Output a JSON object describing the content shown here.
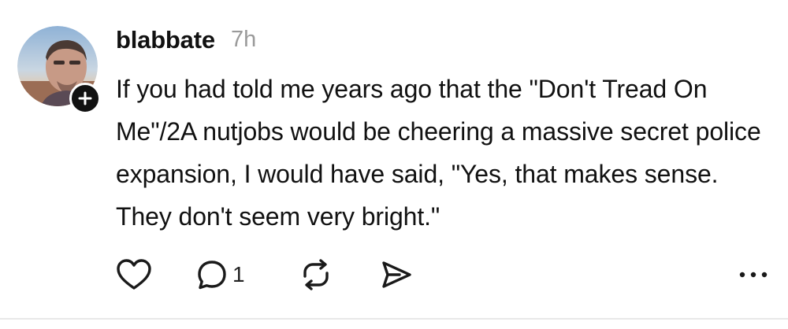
{
  "post": {
    "username": "blabbate",
    "timestamp": "7h",
    "text": "If you had told me years ago that the \"Don't Tread On Me\"/2A nutjobs would be cheering a massive secret police expansion, I would have said, \"Yes, that makes sense. They don't seem very bright.\"",
    "avatar": {
      "icon": "profile-photo",
      "follow_badge_icon": "plus-icon"
    },
    "actions": {
      "like_icon": "heart-icon",
      "reply_icon": "comment-icon",
      "reply_count": "1",
      "repost_icon": "repost-icon",
      "share_icon": "send-icon",
      "more_icon": "more-icon"
    }
  },
  "colors": {
    "text": "#111111",
    "muted": "#9a9a9a",
    "badge": "#111111",
    "divider": "#e8e8e8"
  }
}
